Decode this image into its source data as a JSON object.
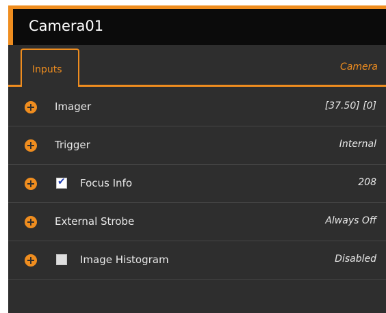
{
  "panel": {
    "title": "Camera01",
    "accent_color": "#ef8d1f",
    "background_color": "#2e2e2e"
  },
  "tabs": {
    "active_tab": "Inputs",
    "module": "Camera"
  },
  "rows": [
    {
      "label": "Imager",
      "value": "[37.50]  [0]",
      "expand_icon": "plus-circle-icon"
    },
    {
      "label": "Trigger",
      "value": "Internal",
      "expand_icon": "plus-circle-icon"
    },
    {
      "label": "Focus Info",
      "value": "208",
      "checked": true,
      "expand_icon": "plus-circle-icon"
    },
    {
      "label": "External Strobe",
      "value": "Always Off",
      "expand_icon": "plus-circle-icon"
    },
    {
      "label": "Image Histogram",
      "value": "Disabled",
      "checked": false,
      "expand_icon": "plus-circle-icon"
    }
  ],
  "check_glyph": "✔"
}
